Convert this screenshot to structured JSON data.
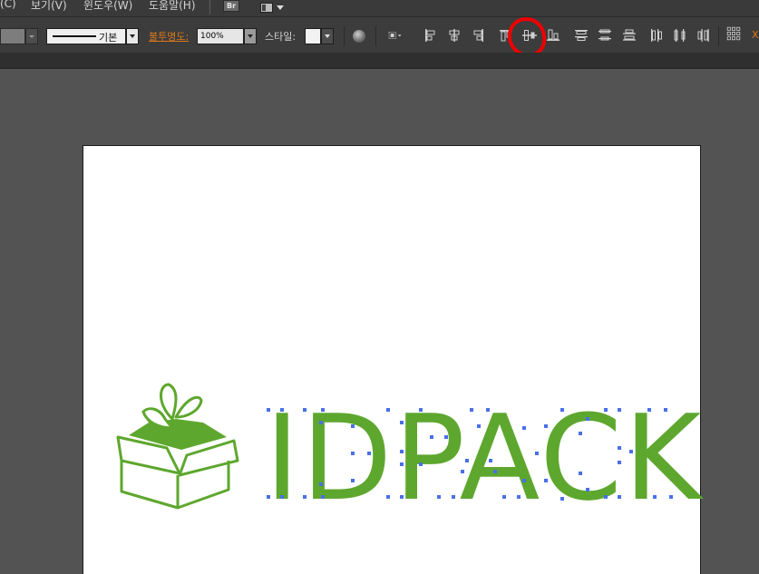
{
  "menubar": {
    "items": [
      {
        "label": "(C)"
      },
      {
        "label": "보기(V)"
      },
      {
        "label": "윈도우(W)"
      },
      {
        "label": "도움말(H)"
      }
    ],
    "bridge_button": "Br"
  },
  "controlbar": {
    "stroke_style_label": "기본",
    "opacity_label": "불투명도:",
    "opacity_value": "100%",
    "style_label": "스타일:",
    "align_tools": [
      "align-left-icon",
      "align-horizontal-center-icon",
      "align-right-icon",
      "align-top-icon",
      "align-vertical-center-icon",
      "align-bottom-icon",
      "distribute-top-icon",
      "distribute-vertical-center-icon",
      "distribute-bottom-icon",
      "distribute-left-icon",
      "distribute-horizontal-center-icon",
      "distribute-right-icon",
      "transform-grid-icon"
    ],
    "highlighted_tool": "align-vertical-center-icon",
    "highlight_color": "#ee0000",
    "last_label": "X"
  },
  "artboard": {
    "logo_text": "IDPACK",
    "logo_color": "#5ea72e",
    "anchor_color": "#4a6fe8"
  }
}
